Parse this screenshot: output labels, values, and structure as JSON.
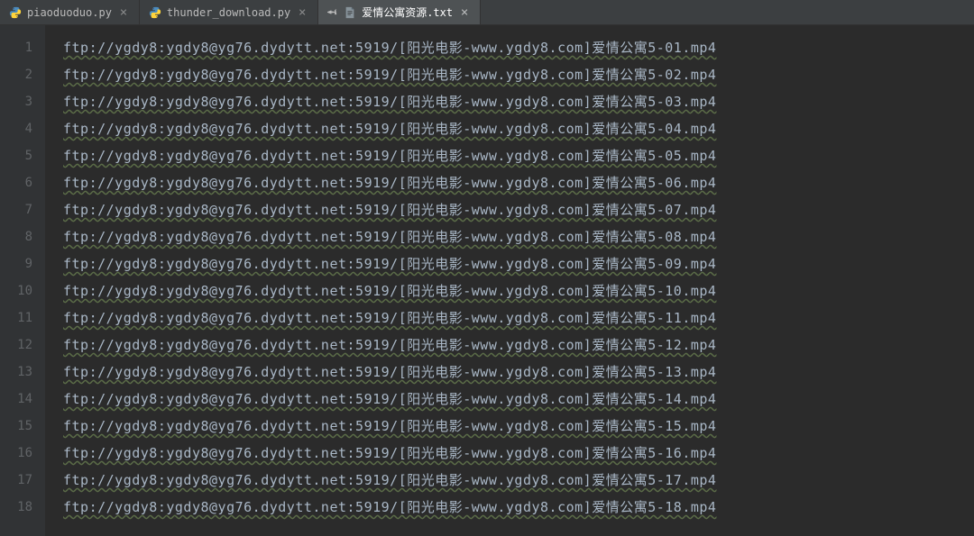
{
  "tabs": [
    {
      "label": "piaoduoduo.py",
      "type": "py",
      "active": false,
      "pinned": false
    },
    {
      "label": "thunder_download.py",
      "type": "py",
      "active": false,
      "pinned": false
    },
    {
      "label": "爱情公寓资源.txt",
      "type": "txt",
      "active": true,
      "pinned": true
    }
  ],
  "lines": [
    {
      "num": "1",
      "text": "ftp://ygdy8:ygdy8@yg76.dydytt.net:5919/[阳光电影-www.ygdy8.com]爱情公寓5-01.mp4"
    },
    {
      "num": "2",
      "text": "ftp://ygdy8:ygdy8@yg76.dydytt.net:5919/[阳光电影-www.ygdy8.com]爱情公寓5-02.mp4"
    },
    {
      "num": "3",
      "text": "ftp://ygdy8:ygdy8@yg76.dydytt.net:5919/[阳光电影-www.ygdy8.com]爱情公寓5-03.mp4"
    },
    {
      "num": "4",
      "text": "ftp://ygdy8:ygdy8@yg76.dydytt.net:5919/[阳光电影-www.ygdy8.com]爱情公寓5-04.mp4"
    },
    {
      "num": "5",
      "text": "ftp://ygdy8:ygdy8@yg76.dydytt.net:5919/[阳光电影-www.ygdy8.com]爱情公寓5-05.mp4"
    },
    {
      "num": "6",
      "text": "ftp://ygdy8:ygdy8@yg76.dydytt.net:5919/[阳光电影-www.ygdy8.com]爱情公寓5-06.mp4"
    },
    {
      "num": "7",
      "text": "ftp://ygdy8:ygdy8@yg76.dydytt.net:5919/[阳光电影-www.ygdy8.com]爱情公寓5-07.mp4"
    },
    {
      "num": "8",
      "text": "ftp://ygdy8:ygdy8@yg76.dydytt.net:5919/[阳光电影-www.ygdy8.com]爱情公寓5-08.mp4"
    },
    {
      "num": "9",
      "text": "ftp://ygdy8:ygdy8@yg76.dydytt.net:5919/[阳光电影-www.ygdy8.com]爱情公寓5-09.mp4"
    },
    {
      "num": "10",
      "text": "ftp://ygdy8:ygdy8@yg76.dydytt.net:5919/[阳光电影-www.ygdy8.com]爱情公寓5-10.mp4"
    },
    {
      "num": "11",
      "text": "ftp://ygdy8:ygdy8@yg76.dydytt.net:5919/[阳光电影-www.ygdy8.com]爱情公寓5-11.mp4"
    },
    {
      "num": "12",
      "text": "ftp://ygdy8:ygdy8@yg76.dydytt.net:5919/[阳光电影-www.ygdy8.com]爱情公寓5-12.mp4"
    },
    {
      "num": "13",
      "text": "ftp://ygdy8:ygdy8@yg76.dydytt.net:5919/[阳光电影-www.ygdy8.com]爱情公寓5-13.mp4"
    },
    {
      "num": "14",
      "text": "ftp://ygdy8:ygdy8@yg76.dydytt.net:5919/[阳光电影-www.ygdy8.com]爱情公寓5-14.mp4"
    },
    {
      "num": "15",
      "text": "ftp://ygdy8:ygdy8@yg76.dydytt.net:5919/[阳光电影-www.ygdy8.com]爱情公寓5-15.mp4"
    },
    {
      "num": "16",
      "text": "ftp://ygdy8:ygdy8@yg76.dydytt.net:5919/[阳光电影-www.ygdy8.com]爱情公寓5-16.mp4"
    },
    {
      "num": "17",
      "text": "ftp://ygdy8:ygdy8@yg76.dydytt.net:5919/[阳光电影-www.ygdy8.com]爱情公寓5-17.mp4"
    },
    {
      "num": "18",
      "text": "ftp://ygdy8:ygdy8@yg76.dydytt.net:5919/[阳光电影-www.ygdy8.com]爱情公寓5-18.mp4"
    }
  ]
}
